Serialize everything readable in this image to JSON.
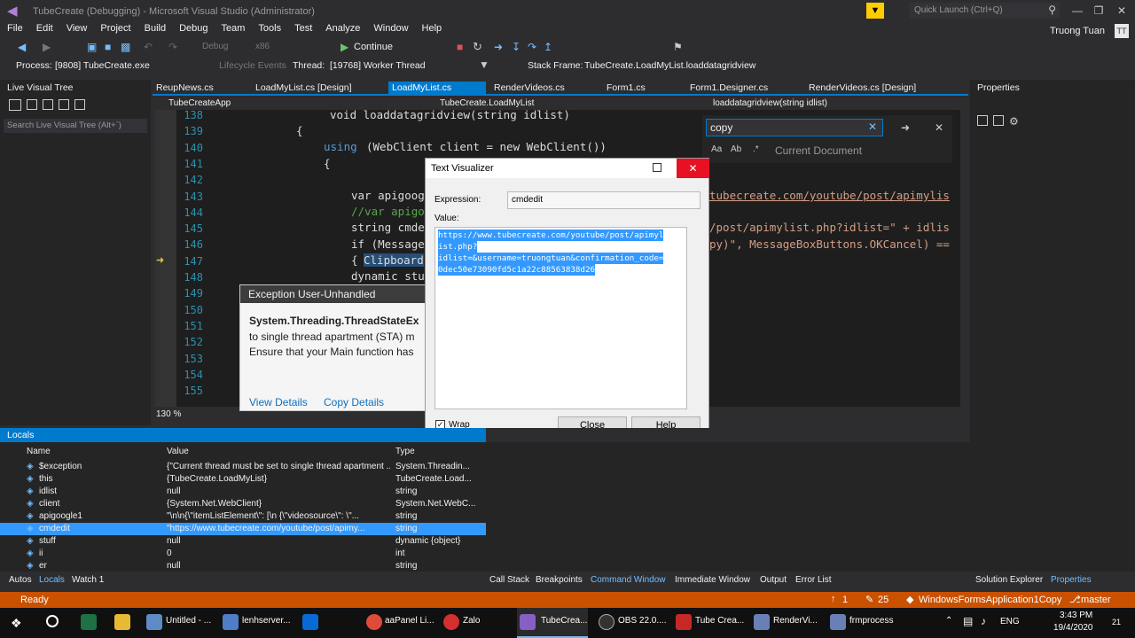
{
  "window": {
    "title": "TubeCreate (Debugging) - Microsoft Visual Studio  (Administrator)",
    "quick_launch": "Quick Launch (Ctrl+Q)",
    "user": "Truong Tuan",
    "user_initials": "TT"
  },
  "menu": [
    "File",
    "Edit",
    "View",
    "Project",
    "Build",
    "Debug",
    "Team",
    "Tools",
    "Test",
    "Analyze",
    "Window",
    "Help"
  ],
  "toolbar": {
    "config": "Debug",
    "platform": "x86",
    "continue": "Continue"
  },
  "debugbar": {
    "process_label": "Process:",
    "process": "[9808] TubeCreate.exe",
    "lifecycle": "Lifecycle Events",
    "thread_label": "Thread:",
    "thread": "[19768] Worker Thread",
    "stack_label": "Stack Frame:",
    "stack": "TubeCreate.LoadMyList.loaddatagridview"
  },
  "live_tree": {
    "title": "Live Visual Tree",
    "search": "Search Live Visual Tree (Alt+`)"
  },
  "tabs": [
    {
      "label": "ReupNews.cs"
    },
    {
      "label": "LoadMyList.cs [Design]"
    },
    {
      "label": "LoadMyList.cs"
    },
    {
      "label": "RenderVideos.cs"
    },
    {
      "label": "Form1.cs"
    },
    {
      "label": "Form1.Designer.cs"
    },
    {
      "label": "RenderVideos.cs [Design]"
    }
  ],
  "nav": {
    "project": "TubeCreateApp",
    "class": "TubeCreate.LoadMyList",
    "member": "loaddatagridview(string idlist)"
  },
  "find": {
    "query": "copy",
    "scope": "Current Document"
  },
  "properties": {
    "title": "Properties"
  },
  "code": {
    "lines": [
      "138",
      "139",
      "140",
      "141",
      "142",
      "143",
      "144",
      "145",
      "146",
      "147",
      "148",
      "149",
      "150",
      "151",
      "152",
      "153",
      "154",
      "155"
    ],
    "zoom": "130 %",
    "text_using": "using",
    "text_webclient_decl": "(WebClient client = new WebClient())",
    "text_var": "var apigoog",
    "text_comment": "//var apigo",
    "text_string": "string cmde",
    "text_if": "if (Message",
    "text_clip": "Clipboard",
    "text_dynamic": "dynamic stu",
    "text_right_url": "tubecreate.com/youtube/post/apimylis",
    "text_right_php": "/post/apimylist.php?idlist=\" + idlis",
    "text_right_mb": "py)\", MessageBoxButtons.OKCancel) ==",
    "text_head": "void loaddatagridview(string idlist)"
  },
  "exception": {
    "title": "Exception User-Unhandled",
    "type": "System.Threading.ThreadStateEx",
    "line1": "to single thread apartment (STA) m",
    "line2": "Ensure that your Main function has",
    "view": "View Details",
    "copy": "Copy Details"
  },
  "dialog": {
    "title": "Text Visualizer",
    "expression_label": "Expression:",
    "expression": "cmdedit",
    "value_label": "Value:",
    "value_lines": [
      "https://www.tubecreate.com/youtube/post/apimyl",
      "ist.php?",
      "idlist=&username=truongtuan&confirmation_code=",
      "0dec50e73090fd5c1a22c88563838d26"
    ],
    "wrap": "Wrap",
    "close": "Close",
    "help": "Help"
  },
  "locals": {
    "title": "Locals",
    "headers": [
      "Name",
      "Value",
      "Type"
    ],
    "rows": [
      {
        "name": "$exception",
        "value": "{\"Current thread must be set to single thread apartment ...",
        "type": "System.Threadin..."
      },
      {
        "name": "this",
        "value": "{TubeCreate.LoadMyList}",
        "type": "TubeCreate.Load..."
      },
      {
        "name": "idlist",
        "value": "null",
        "type": "string"
      },
      {
        "name": "client",
        "value": "{System.Net.WebClient}",
        "type": "System.Net.WebC..."
      },
      {
        "name": "apigoogle1",
        "value": "\"\\n\\n{\\\"itemListElement\\\": [\\n   {\\\"videosource\\\": \\\"...",
        "type": "string"
      },
      {
        "name": "cmdedit",
        "value": "\"https://www.tubecreate.com/youtube/post/apimy...",
        "type": "string"
      },
      {
        "name": "stuff",
        "value": "null",
        "type": "dynamic {object}"
      },
      {
        "name": "ii",
        "value": "0",
        "type": "int"
      },
      {
        "name": "er",
        "value": "null",
        "type": "string"
      }
    ]
  },
  "bottom_tabs_left": [
    "Autos",
    "Locals",
    "Watch 1"
  ],
  "bottom_tabs_right": [
    "Call Stack",
    "Breakpoints",
    "Command Window",
    "Immediate Window",
    "Output",
    "Error List"
  ],
  "bottom_tabs_far": [
    "Solution Explorer",
    "Properties"
  ],
  "status": {
    "ready": "Ready",
    "up": "1",
    "edits": "25",
    "project": "WindowsFormsApplication1Copy",
    "branch": "master"
  },
  "taskbar": {
    "items": [
      "Untitled - ...",
      "lenhserver...",
      "aaPanel Li...",
      "Zalo",
      "TubeCrea...",
      "OBS 22.0....",
      "Tube Crea...",
      "RenderVi...",
      "frmprocess"
    ],
    "lang": "ENG",
    "time": "3:43 PM",
    "date": "19/4/2020",
    "badge": "21"
  },
  "colors": {
    "accent": "#007acc",
    "status": "#ca5100",
    "selection": "#3399ff"
  }
}
